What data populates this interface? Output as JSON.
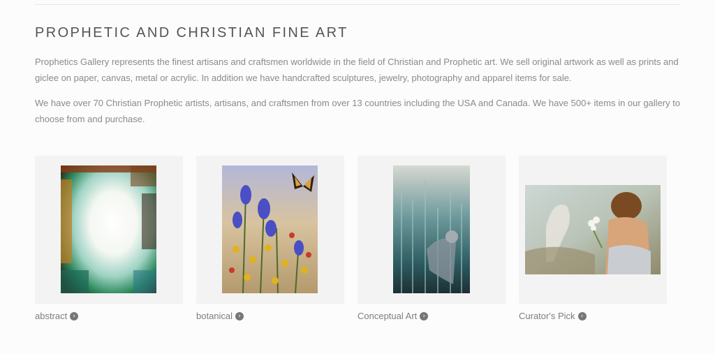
{
  "section": {
    "title": "PROPHETIC AND CHRISTIAN FINE ART",
    "paragraphs": [
      "Prophetics Gallery represents the finest artisans and craftsmen worldwide in the field of Christian and Prophetic art. We sell original artwork as well as prints and giclee on paper, canvas, metal or acrylic. In addition we have handcrafted sculptures, jewelry, photography and apparel items for sale.",
      "We have over 70 Christian Prophetic artists, artisans, and craftsmen from over 13 countries including the USA and Canada. We have 500+ items in our gallery to choose from and purchase."
    ]
  },
  "categories": [
    {
      "label": "abstract",
      "icon": "chevron-circle-right-icon"
    },
    {
      "label": "botanical",
      "icon": "chevron-circle-right-icon"
    },
    {
      "label": "Conceptual Art",
      "icon": "chevron-circle-right-icon"
    },
    {
      "label": "Curator's Pick",
      "icon": "chevron-circle-right-icon"
    }
  ],
  "colors": {
    "heading": "#555555",
    "body_text": "#8a8a8a",
    "thumb_bg": "#f3f3f3"
  }
}
